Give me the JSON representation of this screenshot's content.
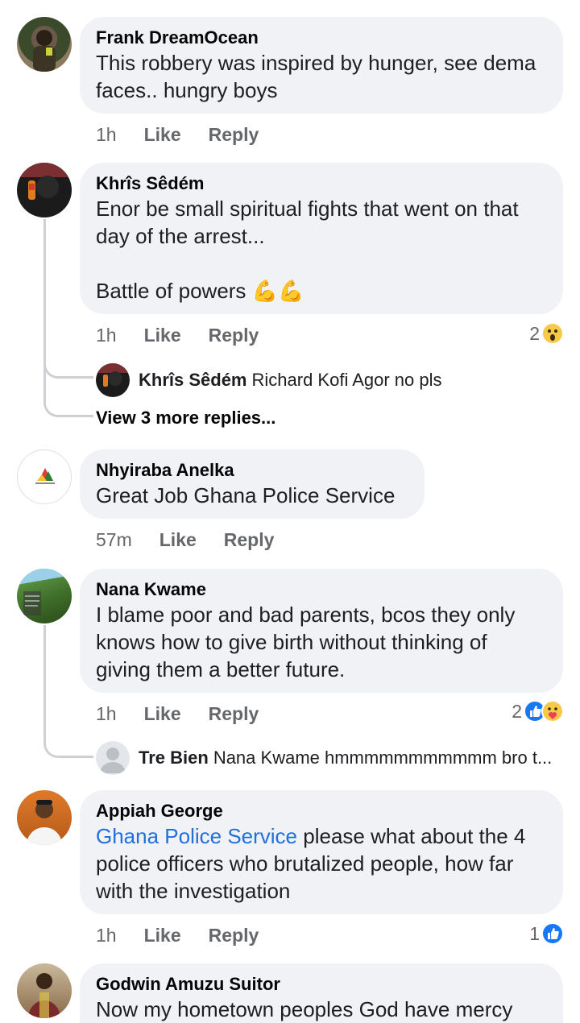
{
  "comments": [
    {
      "author": "Frank DreamOcean",
      "text": "This robbery was inspired by hunger, see dema faces.. hungry boys",
      "time": "1h",
      "like": "Like",
      "reply": "Reply"
    },
    {
      "author": "Khrîs Sêdém",
      "text": "Enor be small spiritual fights that went on that day of the arrest...\n\nBattle of powers",
      "emoji": "💪💪",
      "time": "1h",
      "like": "Like",
      "reply": "Reply",
      "reaction_count": "2",
      "reply_author": "Khrîs Sêdém",
      "reply_text": "Richard Kofi Agor no pls",
      "more_replies": "View 3 more replies..."
    },
    {
      "author": "Nhyiraba Anelka",
      "text": "Great Job Ghana Police Service",
      "time": "57m",
      "like": "Like",
      "reply": "Reply"
    },
    {
      "author": "Nana Kwame",
      "text": "I blame poor and bad parents, bcos they only knows how to give birth without thinking of giving them a better future.",
      "time": "1h",
      "like": "Like",
      "reply": "Reply",
      "reaction_count": "2",
      "reply_author": "Tre Bien",
      "reply_text": "Nana Kwame hmmmmmmmmmmm bro t..."
    },
    {
      "author": "Appiah George",
      "mention": "Ghana Police Service",
      "text": " please what about the 4 police officers who brutalized people, how far with the investigation",
      "time": "1h",
      "like": "Like",
      "reply": "Reply",
      "reaction_count": "1"
    },
    {
      "author": "Godwin Amuzu Suitor",
      "text": "Now my hometown peoples God have mercy"
    }
  ],
  "colors": {
    "bubble": "#f0f2f5",
    "meta": "#65676b",
    "mention": "#216fdb",
    "like_blue": "#1877f2"
  }
}
